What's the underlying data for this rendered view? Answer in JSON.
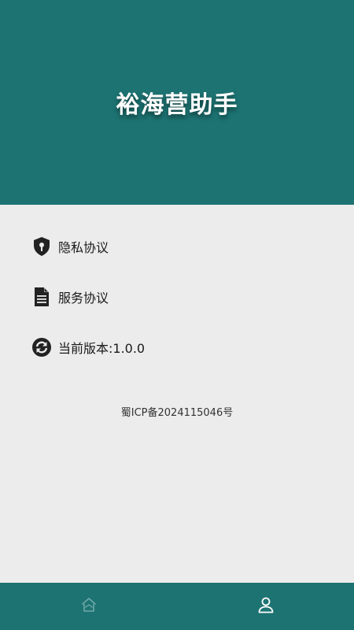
{
  "header": {
    "title": "裕海营助手",
    "background_color": "#1d7372"
  },
  "menu": {
    "items": [
      {
        "label": "隐私协议",
        "icon": "shield-key-icon"
      },
      {
        "label": "服务协议",
        "icon": "document-icon"
      },
      {
        "label": "当前版本:1.0.0",
        "icon": "refresh-icon"
      }
    ]
  },
  "footer_note": {
    "icp": "蜀ICP备2024115046号"
  },
  "tabbar": {
    "tabs": [
      {
        "icon": "home-icon",
        "active": false
      },
      {
        "icon": "user-icon",
        "active": true
      }
    ],
    "background_color": "#1d7372"
  }
}
